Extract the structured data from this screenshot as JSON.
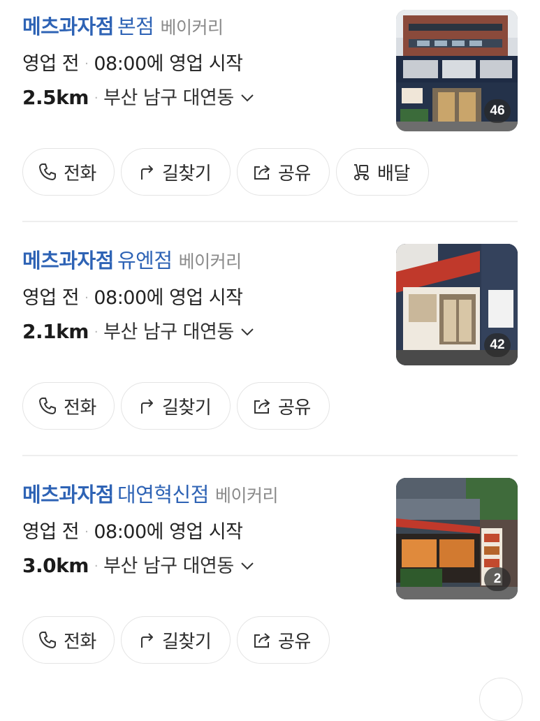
{
  "results": [
    {
      "brand": "메츠과자점",
      "branch": "본점",
      "category": "베이커리",
      "status": "영업 전",
      "hours": "08:00에 영업 시작",
      "distance": "2.5km",
      "address": "부산 남구 대연동",
      "photo_count": "46",
      "actions": [
        {
          "label": "전화",
          "icon": "phone-icon"
        },
        {
          "label": "길찾기",
          "icon": "directions-icon"
        },
        {
          "label": "공유",
          "icon": "share-icon"
        },
        {
          "label": "배달",
          "icon": "delivery-scooter-icon"
        }
      ]
    },
    {
      "brand": "메츠과자점",
      "branch": "유엔점",
      "category": "베이커리",
      "status": "영업 전",
      "hours": "08:00에 영업 시작",
      "distance": "2.1km",
      "address": "부산 남구 대연동",
      "photo_count": "42",
      "actions": [
        {
          "label": "전화",
          "icon": "phone-icon"
        },
        {
          "label": "길찾기",
          "icon": "directions-icon"
        },
        {
          "label": "공유",
          "icon": "share-icon"
        }
      ]
    },
    {
      "brand": "메츠과자점",
      "branch": "대연혁신점",
      "category": "베이커리",
      "status": "영업 전",
      "hours": "08:00에 영업 시작",
      "distance": "3.0km",
      "address": "부산 남구 대연동",
      "photo_count": "2",
      "actions": [
        {
          "label": "전화",
          "icon": "phone-icon"
        },
        {
          "label": "길찾기",
          "icon": "directions-icon"
        },
        {
          "label": "공유",
          "icon": "share-icon"
        }
      ]
    }
  ],
  "separator": "·",
  "colors": {
    "brand_blue": "#2e63b5",
    "category_gray": "#8a8a8a",
    "border_gray": "#e4e4e4"
  }
}
